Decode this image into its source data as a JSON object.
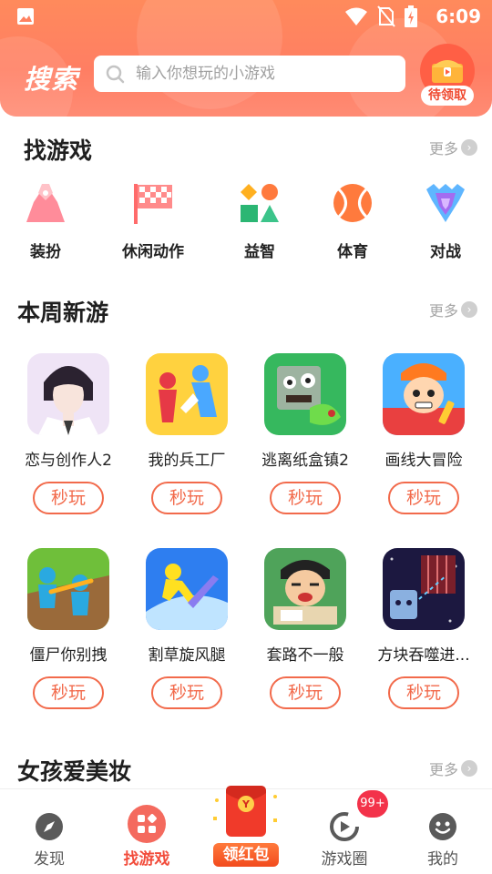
{
  "status_bar": {
    "time": "6:09"
  },
  "header": {
    "title": "搜索",
    "search_placeholder": "输入你想玩的小游戏",
    "reward_label": "待领取"
  },
  "find_games": {
    "title": "找游戏",
    "more_label": "更多",
    "categories": [
      {
        "label": "装扮",
        "icon": "dress-up-icon"
      },
      {
        "label": "休闲动作",
        "icon": "checkered-flag-icon"
      },
      {
        "label": "益智",
        "icon": "puzzle-shapes-icon"
      },
      {
        "label": "体育",
        "icon": "ball-icon"
      },
      {
        "label": "对战",
        "icon": "shield-icon"
      }
    ]
  },
  "new_this_week": {
    "title": "本周新游",
    "more_label": "更多",
    "games": [
      {
        "name": "恋与创作人2",
        "button": "秒玩"
      },
      {
        "name": "我的兵工厂",
        "button": "秒玩"
      },
      {
        "name": "逃离纸盒镇2",
        "button": "秒玩"
      },
      {
        "name": "画线大冒险",
        "button": "秒玩"
      },
      {
        "name": "僵尸你别拽",
        "button": "秒玩"
      },
      {
        "name": "割草旋风腿",
        "button": "秒玩"
      },
      {
        "name": "套路不一般",
        "button": "秒玩"
      },
      {
        "name": "方块吞噬进...",
        "button": "秒玩"
      }
    ]
  },
  "girls_makeup": {
    "title": "女孩爱美妆",
    "more_label": "更多"
  },
  "tab_bar": {
    "tabs": [
      {
        "label": "发现",
        "icon": "compass-icon"
      },
      {
        "label": "找游戏",
        "icon": "grid-icon"
      },
      {
        "label": "领红包",
        "icon": "red-packet-icon"
      },
      {
        "label": "游戏圈",
        "icon": "play-circle-icon"
      },
      {
        "label": "我的",
        "icon": "smiley-icon"
      }
    ],
    "badge": "99+"
  },
  "colors": {
    "accent": "#f26a4b",
    "header": "#ff8160",
    "active_tab": "#f24d3c"
  }
}
